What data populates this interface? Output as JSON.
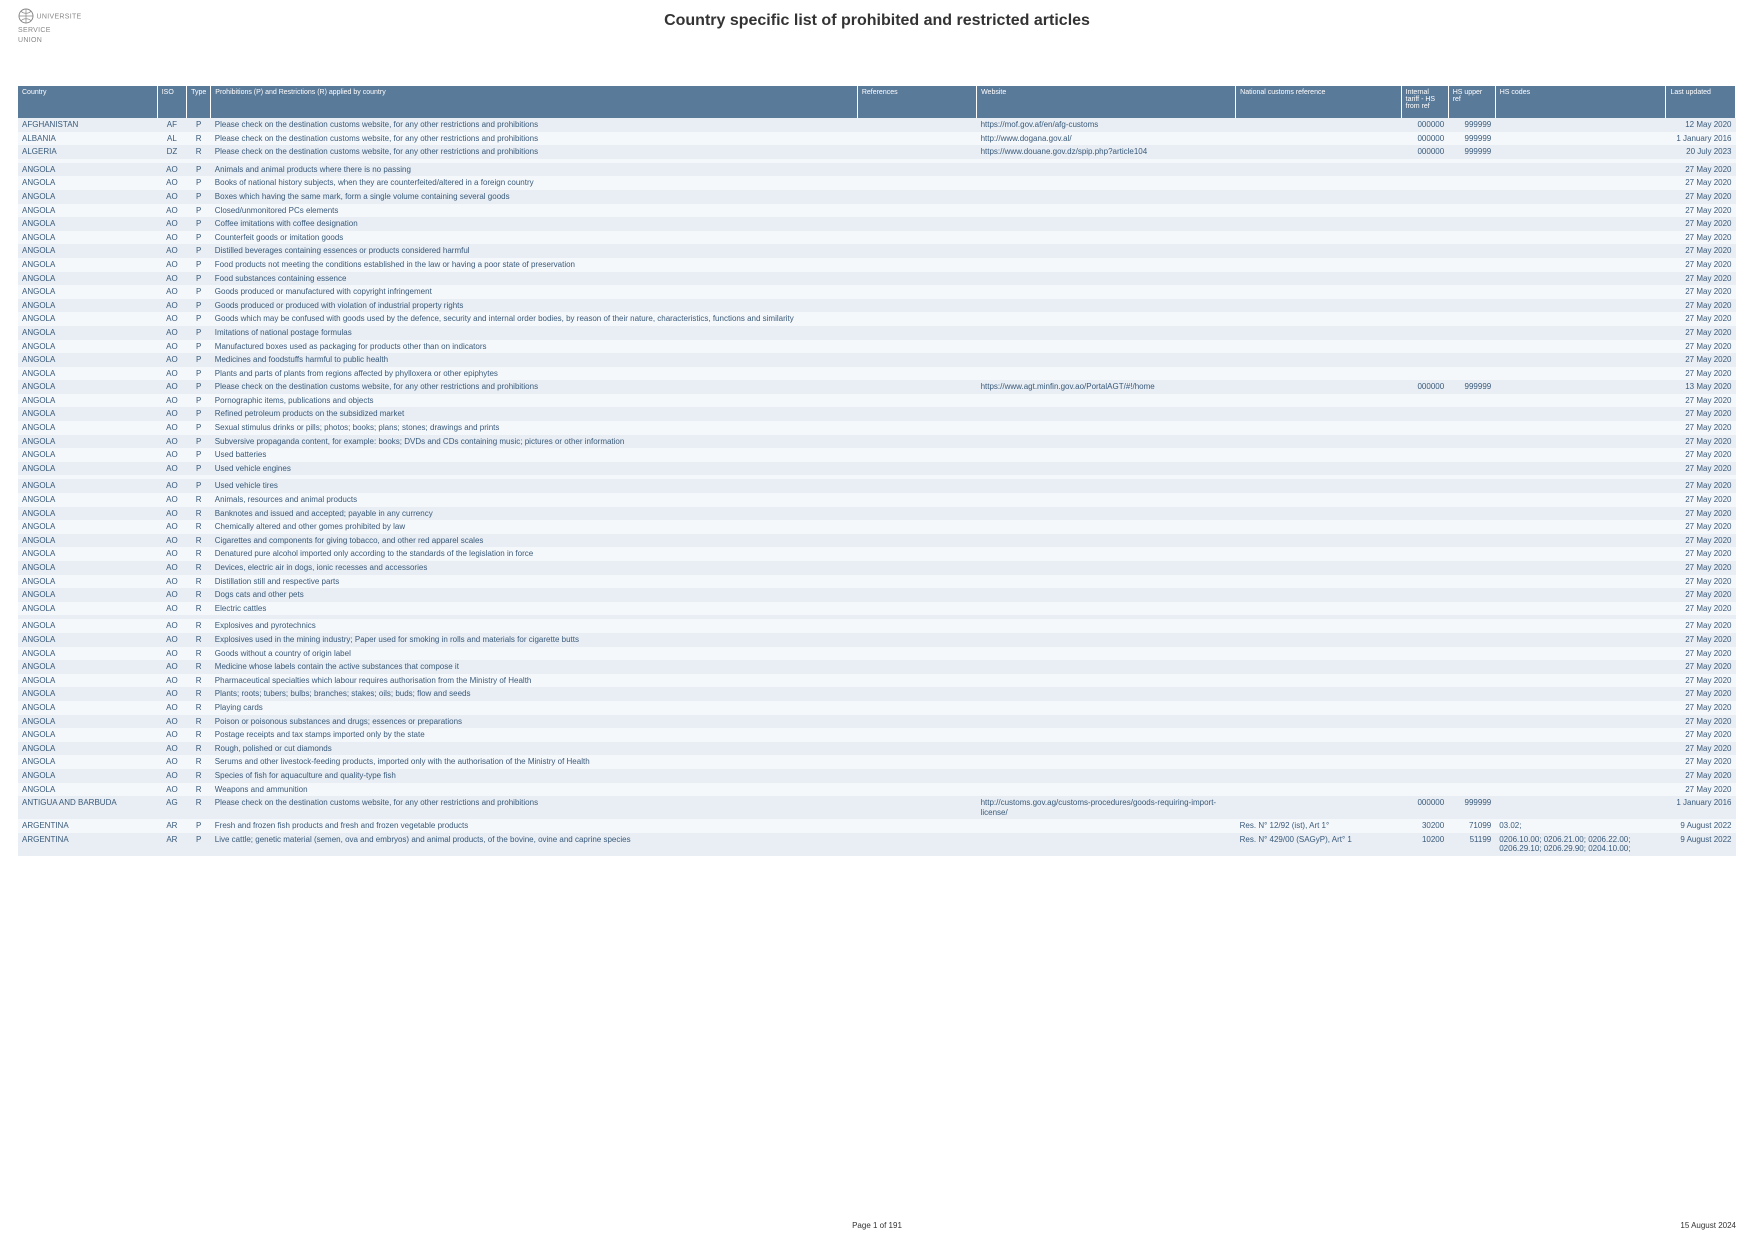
{
  "title": "Country specific list of prohibited and restricted articles",
  "page_label": "Page 1 of 191",
  "footer_date": "15 August 2024",
  "headers": [
    "Country",
    "ISO",
    "Type",
    "Prohibitions (P) and Restrictions (R) applied by country",
    "References",
    "Website",
    "National customs reference",
    "Internal tariff - HS from ref",
    "HS upper ref",
    "HS codes",
    "Last updated"
  ],
  "rows": [
    {
      "country": "AFGHANISTAN",
      "iso": "AF",
      "type": "P",
      "desc": "Please check on the destination customs website, for any other restrictions and prohibitions",
      "ref": "",
      "web": "https://mof.gov.af/en/afg-customs",
      "nat": "",
      "hsf": "000000",
      "hst": "999999",
      "hs": "",
      "upd": "12 May 2020"
    },
    {
      "country": "ALBANIA",
      "iso": "AL",
      "type": "R",
      "desc": "Please check on the destination customs website, for any other restrictions and prohibitions",
      "ref": "",
      "web": "http://www.dogana.gov.al/",
      "nat": "",
      "hsf": "000000",
      "hst": "999999",
      "hs": "",
      "upd": "1 January 2016"
    },
    {
      "country": "ALGERIA",
      "iso": "DZ",
      "type": "R",
      "desc": "Please check on the destination customs website, for any other restrictions and prohibitions",
      "ref": "",
      "web": "https://www.douane.gov.dz/spip.php?article104",
      "nat": "",
      "hsf": "000000",
      "hst": "999999",
      "hs": "",
      "upd": "20 July 2023"
    },
    {
      "country": "",
      "iso": "",
      "type": "",
      "desc": "",
      "ref": "",
      "web": "",
      "nat": "",
      "hsf": "",
      "hst": "",
      "hs": "",
      "upd": ""
    },
    {
      "country": "ANGOLA",
      "iso": "AO",
      "type": "P",
      "desc": "Animals and animal products where there is no passing",
      "ref": "",
      "web": "",
      "nat": "",
      "hsf": "",
      "hst": "",
      "hs": "",
      "upd": "27 May 2020"
    },
    {
      "country": "ANGOLA",
      "iso": "AO",
      "type": "P",
      "desc": "Books of national history subjects, when they are counterfeited/altered in a foreign country",
      "ref": "",
      "web": "",
      "nat": "",
      "hsf": "",
      "hst": "",
      "hs": "",
      "upd": "27 May 2020"
    },
    {
      "country": "ANGOLA",
      "iso": "AO",
      "type": "P",
      "desc": "Boxes which having the same mark, form a single volume containing several goods",
      "ref": "",
      "web": "",
      "nat": "",
      "hsf": "",
      "hst": "",
      "hs": "",
      "upd": "27 May 2020"
    },
    {
      "country": "ANGOLA",
      "iso": "AO",
      "type": "P",
      "desc": "Closed/unmonitored PCs elements",
      "ref": "",
      "web": "",
      "nat": "",
      "hsf": "",
      "hst": "",
      "hs": "",
      "upd": "27 May 2020"
    },
    {
      "country": "ANGOLA",
      "iso": "AO",
      "type": "P",
      "desc": "Coffee imitations with coffee designation",
      "ref": "",
      "web": "",
      "nat": "",
      "hsf": "",
      "hst": "",
      "hs": "",
      "upd": "27 May 2020"
    },
    {
      "country": "ANGOLA",
      "iso": "AO",
      "type": "P",
      "desc": "Counterfeit goods or imitation goods",
      "ref": "",
      "web": "",
      "nat": "",
      "hsf": "",
      "hst": "",
      "hs": "",
      "upd": "27 May 2020"
    },
    {
      "country": "ANGOLA",
      "iso": "AO",
      "type": "P",
      "desc": "Distilled beverages containing essences or products considered harmful",
      "ref": "",
      "web": "",
      "nat": "",
      "hsf": "",
      "hst": "",
      "hs": "",
      "upd": "27 May 2020"
    },
    {
      "country": "ANGOLA",
      "iso": "AO",
      "type": "P",
      "desc": "Food products not meeting the conditions established in the law or having a poor state of preservation",
      "ref": "",
      "web": "",
      "nat": "",
      "hsf": "",
      "hst": "",
      "hs": "",
      "upd": "27 May 2020"
    },
    {
      "country": "ANGOLA",
      "iso": "AO",
      "type": "P",
      "desc": "Food substances containing essence",
      "ref": "",
      "web": "",
      "nat": "",
      "hsf": "",
      "hst": "",
      "hs": "",
      "upd": "27 May 2020"
    },
    {
      "country": "ANGOLA",
      "iso": "AO",
      "type": "P",
      "desc": "Goods produced or manufactured with copyright infringement",
      "ref": "",
      "web": "",
      "nat": "",
      "hsf": "",
      "hst": "",
      "hs": "",
      "upd": "27 May 2020"
    },
    {
      "country": "ANGOLA",
      "iso": "AO",
      "type": "P",
      "desc": "Goods produced or produced with violation of industrial property rights",
      "ref": "",
      "web": "",
      "nat": "",
      "hsf": "",
      "hst": "",
      "hs": "",
      "upd": "27 May 2020"
    },
    {
      "country": "ANGOLA",
      "iso": "AO",
      "type": "P",
      "desc": "Goods which may be confused with goods used by the defence, security and internal order bodies, by reason of their nature, characteristics, functions and similarity",
      "ref": "",
      "web": "",
      "nat": "",
      "hsf": "",
      "hst": "",
      "hs": "",
      "upd": "27 May 2020"
    },
    {
      "country": "ANGOLA",
      "iso": "AO",
      "type": "P",
      "desc": "Imitations of national postage formulas",
      "ref": "",
      "web": "",
      "nat": "",
      "hsf": "",
      "hst": "",
      "hs": "",
      "upd": "27 May 2020"
    },
    {
      "country": "ANGOLA",
      "iso": "AO",
      "type": "P",
      "desc": "Manufactured boxes used as packaging for products other than on indicators",
      "ref": "",
      "web": "",
      "nat": "",
      "hsf": "",
      "hst": "",
      "hs": "",
      "upd": "27 May 2020"
    },
    {
      "country": "ANGOLA",
      "iso": "AO",
      "type": "P",
      "desc": "Medicines and foodstuffs harmful to public health",
      "ref": "",
      "web": "",
      "nat": "",
      "hsf": "",
      "hst": "",
      "hs": "",
      "upd": "27 May 2020"
    },
    {
      "country": "ANGOLA",
      "iso": "AO",
      "type": "P",
      "desc": "Plants and parts of plants from regions affected by phylloxera or other epiphytes",
      "ref": "",
      "web": "",
      "nat": "",
      "hsf": "",
      "hst": "",
      "hs": "",
      "upd": "27 May 2020"
    },
    {
      "country": "ANGOLA",
      "iso": "AO",
      "type": "P",
      "desc": "Please check on the destination customs website, for any other restrictions and prohibitions",
      "ref": "",
      "web": "https://www.agt.minfin.gov.ao/PortalAGT/#!/home",
      "nat": "",
      "hsf": "000000",
      "hst": "999999",
      "hs": "",
      "upd": "13 May 2020"
    },
    {
      "country": "ANGOLA",
      "iso": "AO",
      "type": "P",
      "desc": "Pornographic items, publications and objects",
      "ref": "",
      "web": "",
      "nat": "",
      "hsf": "",
      "hst": "",
      "hs": "",
      "upd": "27 May 2020"
    },
    {
      "country": "ANGOLA",
      "iso": "AO",
      "type": "P",
      "desc": "Refined petroleum products on the subsidized market",
      "ref": "",
      "web": "",
      "nat": "",
      "hsf": "",
      "hst": "",
      "hs": "",
      "upd": "27 May 2020"
    },
    {
      "country": "ANGOLA",
      "iso": "AO",
      "type": "P",
      "desc": "Sexual stimulus drinks or pills; photos; books; plans; stones; drawings and prints",
      "ref": "",
      "web": "",
      "nat": "",
      "hsf": "",
      "hst": "",
      "hs": "",
      "upd": "27 May 2020"
    },
    {
      "country": "ANGOLA",
      "iso": "AO",
      "type": "P",
      "desc": "Subversive propaganda content, for example: books; DVDs and CDs containing music; pictures or other information",
      "ref": "",
      "web": "",
      "nat": "",
      "hsf": "",
      "hst": "",
      "hs": "",
      "upd": "27 May 2020"
    },
    {
      "country": "ANGOLA",
      "iso": "AO",
      "type": "P",
      "desc": "Used batteries",
      "ref": "",
      "web": "",
      "nat": "",
      "hsf": "",
      "hst": "",
      "hs": "",
      "upd": "27 May 2020"
    },
    {
      "country": "ANGOLA",
      "iso": "AO",
      "type": "P",
      "desc": "Used vehicle engines",
      "ref": "",
      "web": "",
      "nat": "",
      "hsf": "",
      "hst": "",
      "hs": "",
      "upd": "27 May 2020"
    },
    {
      "country": "",
      "iso": "",
      "type": "",
      "desc": "",
      "ref": "",
      "web": "",
      "nat": "",
      "hsf": "",
      "hst": "",
      "hs": "",
      "upd": ""
    },
    {
      "country": "ANGOLA",
      "iso": "AO",
      "type": "P",
      "desc": "Used vehicle tires",
      "ref": "",
      "web": "",
      "nat": "",
      "hsf": "",
      "hst": "",
      "hs": "",
      "upd": "27 May 2020"
    },
    {
      "country": "ANGOLA",
      "iso": "AO",
      "type": "R",
      "desc": "Animals, resources and animal products",
      "ref": "",
      "web": "",
      "nat": "",
      "hsf": "",
      "hst": "",
      "hs": "",
      "upd": "27 May 2020"
    },
    {
      "country": "ANGOLA",
      "iso": "AO",
      "type": "R",
      "desc": "Banknotes and issued and accepted; payable in any currency",
      "ref": "",
      "web": "",
      "nat": "",
      "hsf": "",
      "hst": "",
      "hs": "",
      "upd": "27 May 2020"
    },
    {
      "country": "ANGOLA",
      "iso": "AO",
      "type": "R",
      "desc": "Chemically altered and other gomes prohibited by law",
      "ref": "",
      "web": "",
      "nat": "",
      "hsf": "",
      "hst": "",
      "hs": "",
      "upd": "27 May 2020"
    },
    {
      "country": "ANGOLA",
      "iso": "AO",
      "type": "R",
      "desc": "Cigarettes and components for giving tobacco, and other red apparel scales",
      "ref": "",
      "web": "",
      "nat": "",
      "hsf": "",
      "hst": "",
      "hs": "",
      "upd": "27 May 2020"
    },
    {
      "country": "ANGOLA",
      "iso": "AO",
      "type": "R",
      "desc": "Denatured pure alcohol imported only according to the standards of the legislation in force",
      "ref": "",
      "web": "",
      "nat": "",
      "hsf": "",
      "hst": "",
      "hs": "",
      "upd": "27 May 2020"
    },
    {
      "country": "ANGOLA",
      "iso": "AO",
      "type": "R",
      "desc": "Devices, electric air in dogs, ionic recesses and accessories",
      "ref": "",
      "web": "",
      "nat": "",
      "hsf": "",
      "hst": "",
      "hs": "",
      "upd": "27 May 2020"
    },
    {
      "country": "ANGOLA",
      "iso": "AO",
      "type": "R",
      "desc": "Distillation still and respective parts",
      "ref": "",
      "web": "",
      "nat": "",
      "hsf": "",
      "hst": "",
      "hs": "",
      "upd": "27 May 2020"
    },
    {
      "country": "ANGOLA",
      "iso": "AO",
      "type": "R",
      "desc": "Dogs cats and other pets",
      "ref": "",
      "web": "",
      "nat": "",
      "hsf": "",
      "hst": "",
      "hs": "",
      "upd": "27 May 2020"
    },
    {
      "country": "ANGOLA",
      "iso": "AO",
      "type": "R",
      "desc": "Electric cattles",
      "ref": "",
      "web": "",
      "nat": "",
      "hsf": "",
      "hst": "",
      "hs": "",
      "upd": "27 May 2020"
    },
    {
      "country": "",
      "iso": "",
      "type": "",
      "desc": "",
      "ref": "",
      "web": "",
      "nat": "",
      "hsf": "",
      "hst": "",
      "hs": "",
      "upd": ""
    },
    {
      "country": "ANGOLA",
      "iso": "AO",
      "type": "R",
      "desc": "Explosives and pyrotechnics",
      "ref": "",
      "web": "",
      "nat": "",
      "hsf": "",
      "hst": "",
      "hs": "",
      "upd": "27 May 2020"
    },
    {
      "country": "ANGOLA",
      "iso": "AO",
      "type": "R",
      "desc": "Explosives used in the mining industry; Paper used for smoking in rolls and materials for cigarette butts",
      "ref": "",
      "web": "",
      "nat": "",
      "hsf": "",
      "hst": "",
      "hs": "",
      "upd": "27 May 2020"
    },
    {
      "country": "ANGOLA",
      "iso": "AO",
      "type": "R",
      "desc": "Goods without a country of origin label",
      "ref": "",
      "web": "",
      "nat": "",
      "hsf": "",
      "hst": "",
      "hs": "",
      "upd": "27 May 2020"
    },
    {
      "country": "ANGOLA",
      "iso": "AO",
      "type": "R",
      "desc": "Medicine whose labels contain the active substances that compose it",
      "ref": "",
      "web": "",
      "nat": "",
      "hsf": "",
      "hst": "",
      "hs": "",
      "upd": "27 May 2020"
    },
    {
      "country": "ANGOLA",
      "iso": "AO",
      "type": "R",
      "desc": "Pharmaceutical specialties which labour requires authorisation from the Ministry of Health",
      "ref": "",
      "web": "",
      "nat": "",
      "hsf": "",
      "hst": "",
      "hs": "",
      "upd": "27 May 2020"
    },
    {
      "country": "ANGOLA",
      "iso": "AO",
      "type": "R",
      "desc": "Plants; roots; tubers; bulbs; branches; stakes; oils; buds; flow and seeds",
      "ref": "",
      "web": "",
      "nat": "",
      "hsf": "",
      "hst": "",
      "hs": "",
      "upd": "27 May 2020"
    },
    {
      "country": "ANGOLA",
      "iso": "AO",
      "type": "R",
      "desc": "Playing cards",
      "ref": "",
      "web": "",
      "nat": "",
      "hsf": "",
      "hst": "",
      "hs": "",
      "upd": "27 May 2020"
    },
    {
      "country": "ANGOLA",
      "iso": "AO",
      "type": "R",
      "desc": "Poison or poisonous substances and drugs; essences or preparations",
      "ref": "",
      "web": "",
      "nat": "",
      "hsf": "",
      "hst": "",
      "hs": "",
      "upd": "27 May 2020"
    },
    {
      "country": "ANGOLA",
      "iso": "AO",
      "type": "R",
      "desc": "Postage receipts and tax stamps imported only by the state",
      "ref": "",
      "web": "",
      "nat": "",
      "hsf": "",
      "hst": "",
      "hs": "",
      "upd": "27 May 2020"
    },
    {
      "country": "ANGOLA",
      "iso": "AO",
      "type": "R",
      "desc": "Rough, polished or cut diamonds",
      "ref": "",
      "web": "",
      "nat": "",
      "hsf": "",
      "hst": "",
      "hs": "",
      "upd": "27 May 2020"
    },
    {
      "country": "ANGOLA",
      "iso": "AO",
      "type": "R",
      "desc": "Serums and other livestock-feeding products, imported only with the authorisation of the Ministry of Health",
      "ref": "",
      "web": "",
      "nat": "",
      "hsf": "",
      "hst": "",
      "hs": "",
      "upd": "27 May 2020"
    },
    {
      "country": "ANGOLA",
      "iso": "AO",
      "type": "R",
      "desc": "Species of fish for aquaculture and quality-type fish",
      "ref": "",
      "web": "",
      "nat": "",
      "hsf": "",
      "hst": "",
      "hs": "",
      "upd": "27 May 2020"
    },
    {
      "country": "ANGOLA",
      "iso": "AO",
      "type": "R",
      "desc": "Weapons and ammunition",
      "ref": "",
      "web": "",
      "nat": "",
      "hsf": "",
      "hst": "",
      "hs": "",
      "upd": "27 May 2020"
    },
    {
      "country": "ANTIGUA AND BARBUDA",
      "iso": "AG",
      "type": "R",
      "desc": "Please check on the destination customs website, for any other restrictions and prohibitions",
      "ref": "",
      "web": "http://customs.gov.ag/customs-procedures/goods-requiring-import-license/",
      "nat": "",
      "hsf": "000000",
      "hst": "999999",
      "hs": "",
      "upd": "1 January 2016"
    },
    {
      "country": "ARGENTINA",
      "iso": "AR",
      "type": "P",
      "desc": "Fresh and frozen fish products and fresh and frozen vegetable products",
      "ref": "",
      "web": "",
      "nat": "Res. N° 12/92 (ist), Art 1°",
      "hsf": "30200",
      "hst": "71099",
      "hs": "03.02;",
      "upd": "9 August 2022"
    },
    {
      "country": "ARGENTINA",
      "iso": "AR",
      "type": "P",
      "desc": "Live cattle; genetic material (semen, ova and embryos) and animal products, of the bovine, ovine and caprine species",
      "ref": "",
      "web": "",
      "nat": "Res. N° 429/00 (SAGyP), Art° 1",
      "hsf": "10200",
      "hst": "51199",
      "hs": "0206.10.00; 0206.21.00; 0206.22.00; 0206.29.10; 0206.29.90; 0204.10.00;",
      "upd": "9 August 2022"
    }
  ]
}
